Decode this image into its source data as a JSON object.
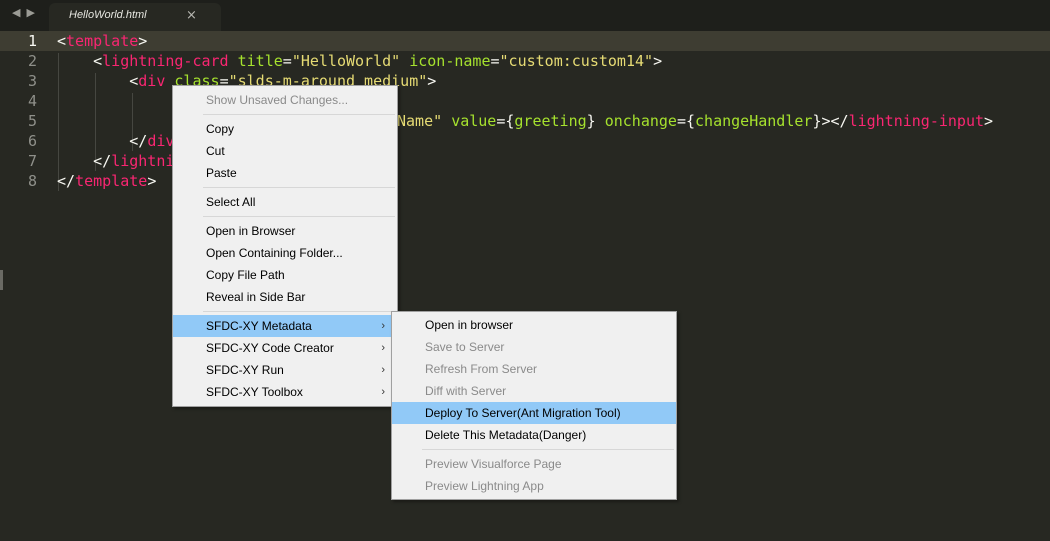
{
  "tabbar": {
    "nav_back": "◀",
    "nav_forward": "▶",
    "tab_title": "HelloWorld.html",
    "tab_close": "×"
  },
  "editor": {
    "line_numbers": [
      "1",
      "2",
      "3",
      "4",
      "5",
      "6",
      "7",
      "8"
    ],
    "active_line": 1,
    "lines": {
      "l1": [
        {
          "t": "<",
          "c": "plain"
        },
        {
          "t": "template",
          "c": "tag"
        },
        {
          "t": ">",
          "c": "plain"
        }
      ],
      "l2": [
        {
          "t": "    <",
          "c": "plain"
        },
        {
          "t": "lightning-card",
          "c": "tag"
        },
        {
          "t": " ",
          "c": "plain"
        },
        {
          "t": "title",
          "c": "attr"
        },
        {
          "t": "=",
          "c": "plain"
        },
        {
          "t": "\"HelloWorld\"",
          "c": "str"
        },
        {
          "t": " ",
          "c": "plain"
        },
        {
          "t": "icon-name",
          "c": "attr"
        },
        {
          "t": "=",
          "c": "plain"
        },
        {
          "t": "\"custom:custom14\"",
          "c": "str"
        },
        {
          "t": ">",
          "c": "plain"
        }
      ],
      "l3": [
        {
          "t": "        <",
          "c": "plain"
        },
        {
          "t": "div",
          "c": "tag"
        },
        {
          "t": " ",
          "c": "plain"
        },
        {
          "t": "class",
          "c": "attr"
        },
        {
          "t": "=",
          "c": "plain"
        },
        {
          "t": "\"slds-m-around_medium\"",
          "c": "str"
        },
        {
          "t": ">",
          "c": "plain"
        }
      ],
      "l5_tail": [
        {
          "t": "Name\"",
          "c": "str"
        },
        {
          "t": " ",
          "c": "plain"
        },
        {
          "t": "value",
          "c": "attr"
        },
        {
          "t": "={",
          "c": "plain"
        },
        {
          "t": "greeting",
          "c": "attr"
        },
        {
          "t": "}",
          "c": "plain"
        },
        {
          "t": " ",
          "c": "plain"
        },
        {
          "t": "onchange",
          "c": "attr"
        },
        {
          "t": "={",
          "c": "plain"
        },
        {
          "t": "changeHandler",
          "c": "attr"
        },
        {
          "t": "}></",
          "c": "plain"
        },
        {
          "t": "lightning-input",
          "c": "tag"
        },
        {
          "t": ">",
          "c": "plain"
        }
      ],
      "l6": [
        {
          "t": "        </",
          "c": "plain"
        },
        {
          "t": "div",
          "c": "tag"
        }
      ],
      "l7": [
        {
          "t": "    </",
          "c": "plain"
        },
        {
          "t": "lightni",
          "c": "tag"
        }
      ],
      "l8": [
        {
          "t": "</",
          "c": "plain"
        },
        {
          "t": "template",
          "c": "tag"
        },
        {
          "t": ">",
          "c": "plain"
        }
      ]
    }
  },
  "context_menu": {
    "items": [
      {
        "label": "Show Unsaved Changes...",
        "disabled": true
      },
      {
        "sep": true
      },
      {
        "label": "Copy"
      },
      {
        "label": "Cut"
      },
      {
        "label": "Paste"
      },
      {
        "sep": true
      },
      {
        "label": "Select All"
      },
      {
        "sep": true
      },
      {
        "label": "Open in Browser"
      },
      {
        "label": "Open Containing Folder..."
      },
      {
        "label": "Copy File Path"
      },
      {
        "label": "Reveal in Side Bar"
      },
      {
        "sep": true
      },
      {
        "label": "SFDC-XY Metadata",
        "submenu": true,
        "highlighted": true
      },
      {
        "label": "SFDC-XY Code Creator",
        "submenu": true
      },
      {
        "label": "SFDC-XY Run",
        "submenu": true
      },
      {
        "label": "SFDC-XY Toolbox",
        "submenu": true
      }
    ]
  },
  "submenu": {
    "items": [
      {
        "label": "Open in browser"
      },
      {
        "label": "Save to Server",
        "disabled": true
      },
      {
        "label": "Refresh From Server",
        "disabled": true
      },
      {
        "label": "Diff with Server",
        "disabled": true
      },
      {
        "label": "Deploy To Server(Ant Migration Tool)",
        "highlighted": true
      },
      {
        "label": "Delete This Metadata(Danger)"
      },
      {
        "sep": true
      },
      {
        "label": "Preview Visualforce Page",
        "disabled": true
      },
      {
        "label": "Preview Lightning App",
        "disabled": true
      }
    ]
  },
  "submenu_arrow": "›"
}
